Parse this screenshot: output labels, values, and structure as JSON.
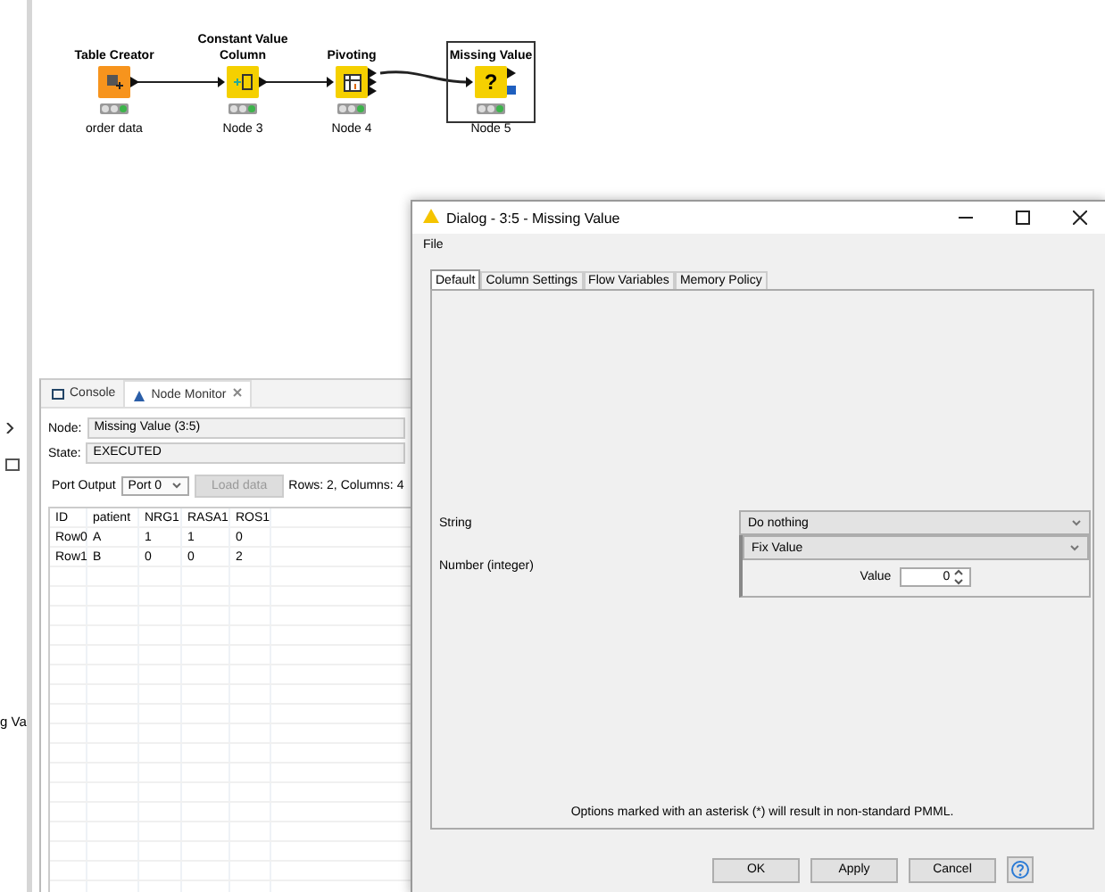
{
  "side_panel": {
    "cut_label": "g Va"
  },
  "workflow": {
    "nodes": [
      {
        "title": "Table Creator",
        "label": "order data",
        "kind": "creator",
        "color": "#f7941d",
        "executed": true,
        "selected": false
      },
      {
        "title": "Constant Value Column",
        "label": "Node 3",
        "kind": "constant",
        "color": "#f5d000",
        "executed": true,
        "selected": false
      },
      {
        "title": "Pivoting",
        "label": "Node 4",
        "kind": "pivot",
        "color": "#f5d000",
        "executed": true,
        "selected": false
      },
      {
        "title": "Missing Value",
        "label": "Node 5",
        "kind": "missing",
        "color": "#f5d000",
        "glyph": "?",
        "executed": true,
        "selected": true
      }
    ]
  },
  "node_monitor": {
    "tabs": [
      {
        "label": "Console",
        "selected": false
      },
      {
        "label": "Node Monitor",
        "selected": true
      }
    ],
    "node_label": "Node:",
    "node_value": "Missing Value  (3:5)",
    "state_label": "State:",
    "state_value": "EXECUTED",
    "port_label": "Port Output",
    "port_select": "Port 0",
    "load_button": {
      "label": "Load data",
      "disabled": true
    },
    "summary": "Rows: 2, Columns: 4",
    "table": {
      "columns": [
        "ID",
        "patient",
        "NRG1",
        "RASA1",
        "ROS1"
      ],
      "rows": [
        [
          "Row0",
          "A",
          "1",
          "1",
          "0"
        ],
        [
          "Row1",
          "B",
          "0",
          "0",
          "2"
        ]
      ]
    }
  },
  "dialog": {
    "title": "Dialog - 3:5 - Missing Value",
    "menu": [
      "File"
    ],
    "tabs": [
      {
        "label": "Default",
        "selected": true
      },
      {
        "label": "Column Settings",
        "selected": false
      },
      {
        "label": "Flow Variables",
        "selected": false
      },
      {
        "label": "Memory Policy",
        "selected": false
      }
    ],
    "settings": [
      {
        "label": "String",
        "select": "Do nothing"
      },
      {
        "label": "Number (integer)",
        "select": "Fix Value",
        "value_label": "Value",
        "value": "0"
      }
    ],
    "note": "Options marked with an asterisk (*) will result in non-standard PMML.",
    "buttons": [
      "OK",
      "Apply",
      "Cancel"
    ]
  }
}
